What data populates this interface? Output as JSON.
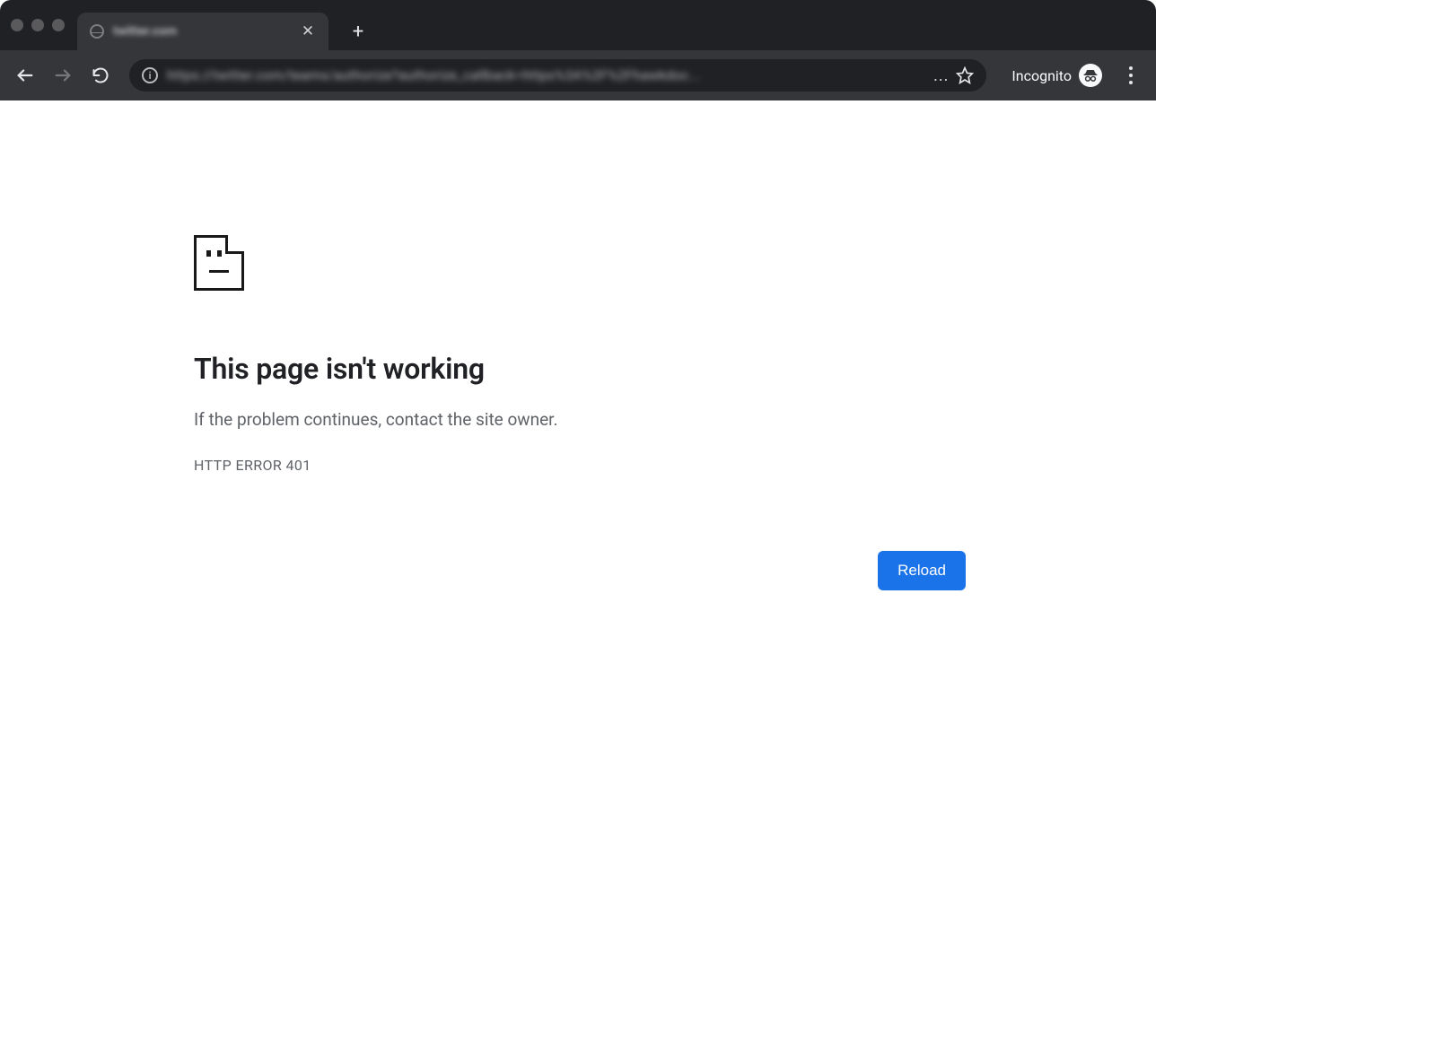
{
  "browser": {
    "tab_title": "twitter.com",
    "url_display": "https://twitter.com/teams/authorize?authorize_callback=https%3A%2F%2Fhawkdoc...",
    "url_ellipsis": "...",
    "incognito_label": "Incognito"
  },
  "error": {
    "heading": "This page isn't working",
    "subtext": "If the problem continues, contact the site owner.",
    "code": "HTTP ERROR 401",
    "reload_label": "Reload"
  }
}
